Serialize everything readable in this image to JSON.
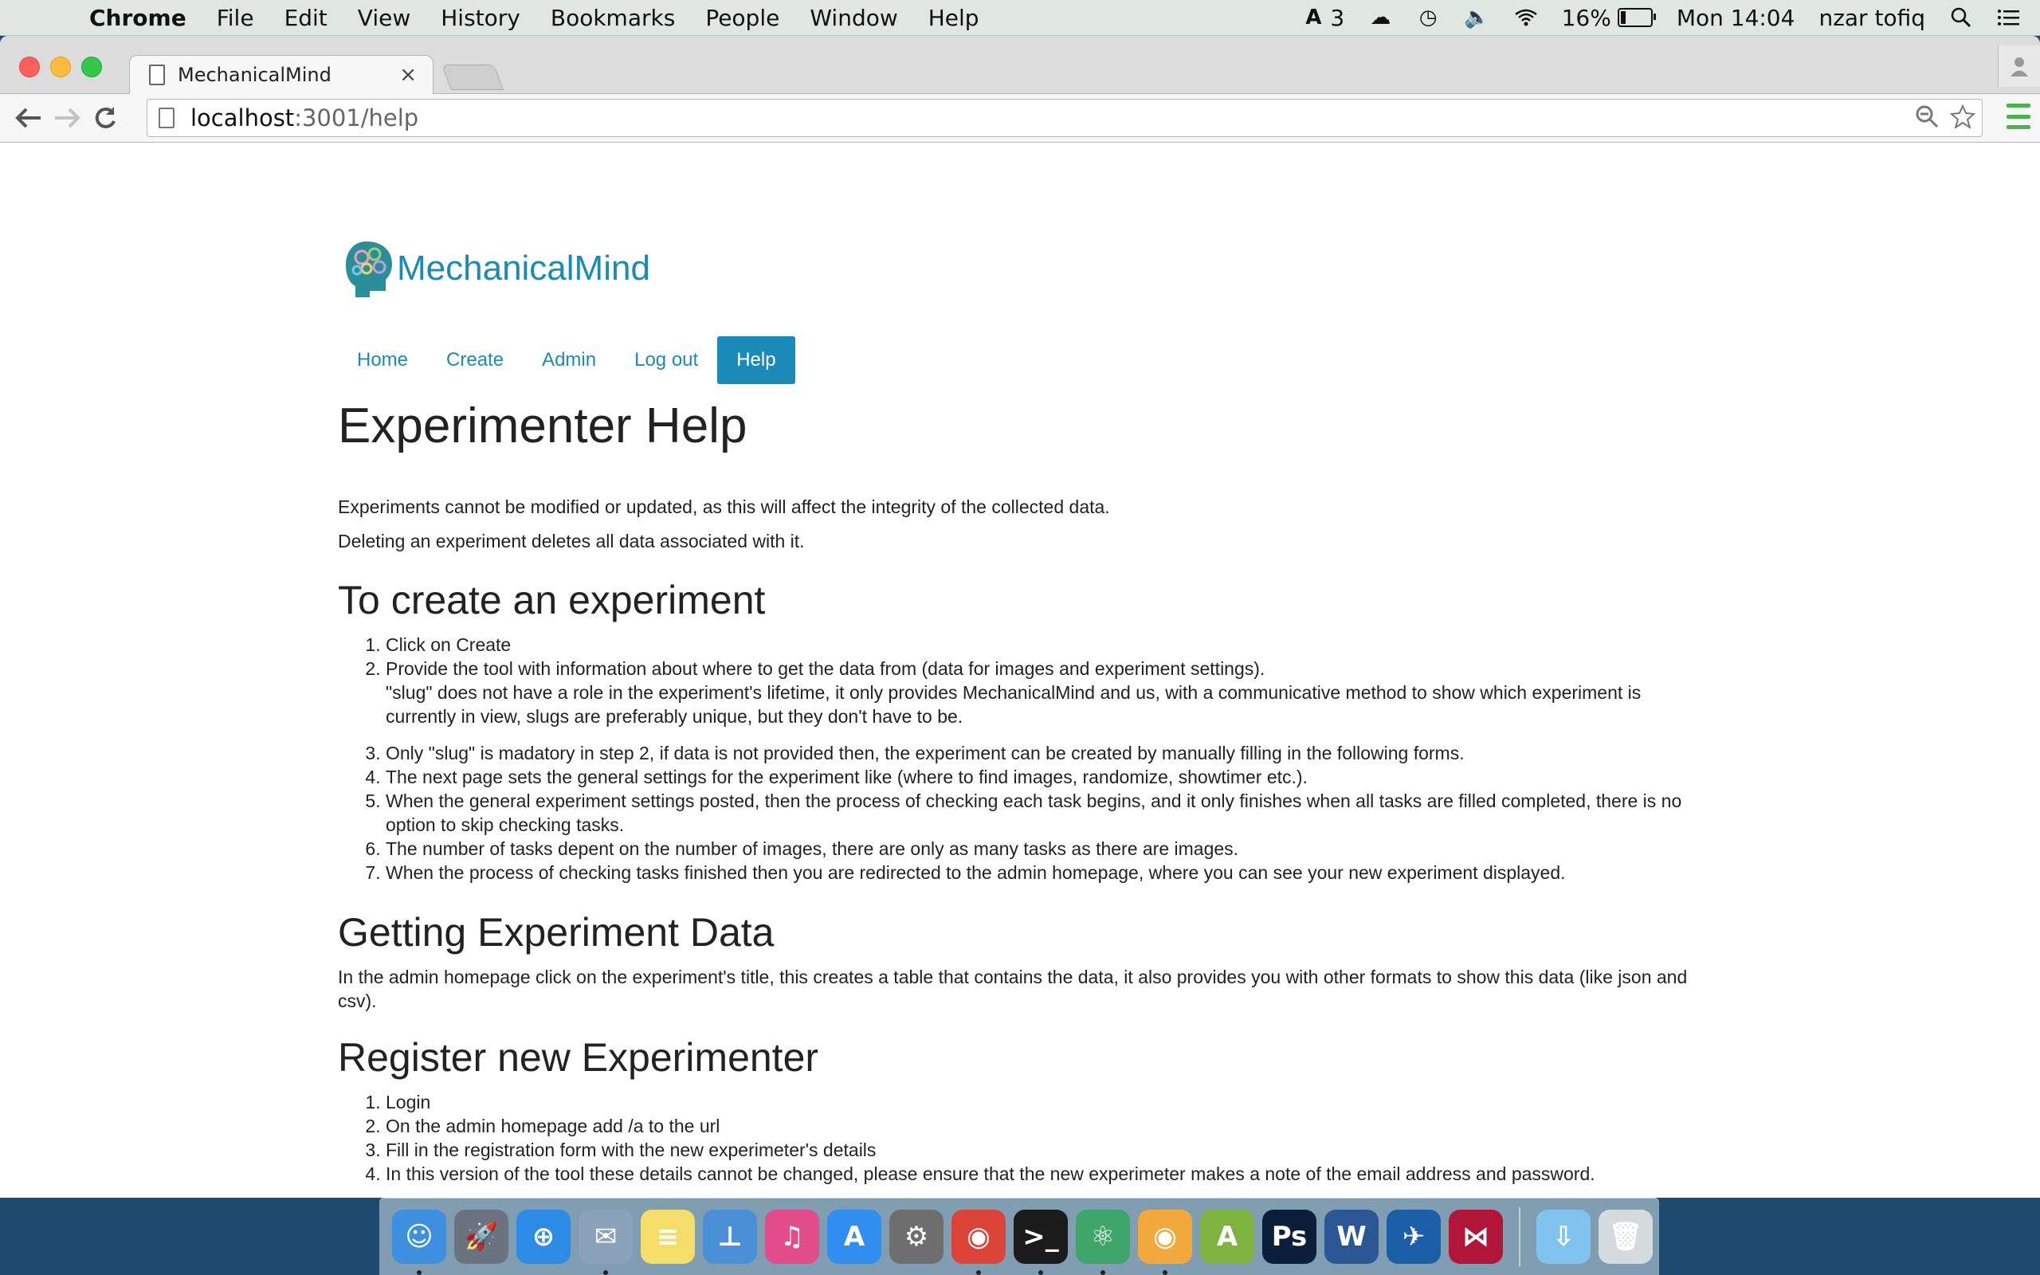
{
  "menubar": {
    "app_name": "Chrome",
    "menus": [
      "File",
      "Edit",
      "View",
      "History",
      "Bookmarks",
      "People",
      "Window",
      "Help"
    ],
    "adobe_count": "3",
    "battery_percent": "16%",
    "battery_level": 0.16,
    "clock": "Mon 14:04",
    "user": "nzar tofiq"
  },
  "browser": {
    "tab_title": "MechanicalMind",
    "tab_close": "×",
    "url_host": "localhost",
    "url_path": ":3001/help"
  },
  "site": {
    "brand_name": "MechanicalMind",
    "nav": {
      "home": "Home",
      "create": "Create",
      "admin": "Admin",
      "logout": "Log out",
      "help": "Help"
    }
  },
  "help": {
    "title": "Experimenter Help",
    "intro1": "Experiments cannot be modified or updated, as this will affect the integrity of the collected data.",
    "intro2": "Deleting an experiment deletes all data associated with it.",
    "create_heading": "To create an experiment",
    "create_steps": [
      "Click on Create",
      "Provide the tool with information about where to get the data from (data for images and experiment settings).",
      "\"slug\" does not have a role in the experiment's lifetime, it only provides MechanicalMind and us, with a communicative method to show which experiment is currently in view, slugs are preferably unique, but they don't have to be.",
      "Only \"slug\" is madatory in step 2, if data is not provided then, the experiment can be created by manually filling in the following forms.",
      "The next page sets the general settings for the experiment like (where to find images, randomize, showtimer etc.).",
      "When the general experiment settings posted, then the process of checking each task begins, and it only finishes when all tasks are filled completed, there is no option to skip checking tasks.",
      "The number of tasks depent on the number of images, there are only as many tasks as there are images.",
      "When the process of checking tasks finished then you are redirected to the admin homepage, where you can see your new experiment displayed."
    ],
    "data_heading": "Getting Experiment Data",
    "data_text": "In the admin homepage click on the experiment's title, this creates a table that contains the data, it also provides you with other formats to show this data (like json and csv).",
    "register_heading": "Register new Experimenter",
    "register_steps": [
      "Login",
      "On the admin homepage add /a to the url",
      "Fill in the registration form with the new experimeter's details",
      "In this version of the tool these details cannot be changed, please ensure that the new experimeter makes a note of the email address and password."
    ]
  },
  "dock": [
    {
      "name": "finder-icon",
      "color": "#3d8fe0",
      "glyph": "☺",
      "running": true
    },
    {
      "name": "launchpad-icon",
      "color": "#6b7280",
      "glyph": "🚀",
      "running": false
    },
    {
      "name": "safari-icon",
      "color": "#2b8be6",
      "glyph": "⊕",
      "running": false
    },
    {
      "name": "preview-icon",
      "color": "#8aa3b8",
      "glyph": "✉",
      "running": true
    },
    {
      "name": "notes-icon",
      "color": "#f5dd6a",
      "glyph": "≡",
      "running": false
    },
    {
      "name": "keynote-icon",
      "color": "#4a90d9",
      "glyph": "⊥",
      "running": false
    },
    {
      "name": "itunes-icon",
      "color": "#e34c8a",
      "glyph": "♫",
      "running": false
    },
    {
      "name": "app-store-icon",
      "color": "#2f8ef0",
      "glyph": "A",
      "running": false
    },
    {
      "name": "system-preferences-icon",
      "color": "#6e6e6e",
      "glyph": "⚙",
      "running": false
    },
    {
      "name": "chrome-icon",
      "color": "#db4437",
      "glyph": "◉",
      "running": true
    },
    {
      "name": "terminal-icon",
      "color": "#1b1b1b",
      "glyph": ">_",
      "running": true
    },
    {
      "name": "atom-icon",
      "color": "#3fa66b",
      "glyph": "⚛",
      "running": true
    },
    {
      "name": "chrome-canary-icon",
      "color": "#f2a93b",
      "glyph": "◉",
      "running": true
    },
    {
      "name": "android-studio-icon",
      "color": "#7fb33f",
      "glyph": "A",
      "running": false
    },
    {
      "name": "photoshop-icon",
      "color": "#0b1e3a",
      "glyph": "Ps",
      "running": false
    },
    {
      "name": "word-icon",
      "color": "#2b5797",
      "glyph": "W",
      "running": false
    },
    {
      "name": "wireshark-icon",
      "color": "#1b5ea8",
      "glyph": "✈",
      "running": false
    },
    {
      "name": "mendeley-icon",
      "color": "#b1163a",
      "glyph": "⋈",
      "running": false
    },
    {
      "name": "downloads-folder-icon",
      "color": "#7fc3ee",
      "glyph": "⇩",
      "running": false
    },
    {
      "name": "trash-icon",
      "color": "#d5dadd",
      "glyph": "🗑",
      "running": false
    }
  ]
}
